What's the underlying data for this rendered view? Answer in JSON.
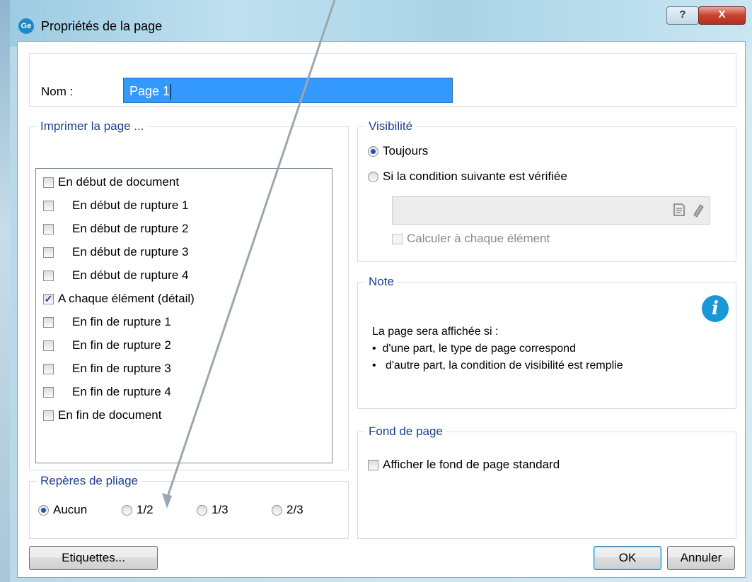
{
  "window": {
    "title": "Propriétés de la page",
    "app_icon_text": "Ge",
    "help_label": "?",
    "close_label": "X"
  },
  "name": {
    "label": "Nom :",
    "value": "Page 1"
  },
  "print_group": {
    "title": "Imprimer la page ...",
    "items": [
      {
        "label": "En début de document",
        "checked": false,
        "indent": false
      },
      {
        "label": "En début de rupture 1",
        "checked": false,
        "indent": true
      },
      {
        "label": "En début de rupture 2",
        "checked": false,
        "indent": true
      },
      {
        "label": "En début de rupture 3",
        "checked": false,
        "indent": true
      },
      {
        "label": "En début de rupture 4",
        "checked": false,
        "indent": true
      },
      {
        "label": "A chaque élément  (détail)",
        "checked": true,
        "indent": false
      },
      {
        "label": "En fin de rupture 1",
        "checked": false,
        "indent": true
      },
      {
        "label": "En fin de rupture 2",
        "checked": false,
        "indent": true
      },
      {
        "label": "En fin de rupture 3",
        "checked": false,
        "indent": true
      },
      {
        "label": "En fin de rupture 4",
        "checked": false,
        "indent": true
      },
      {
        "label": "En fin de document",
        "checked": false,
        "indent": false
      }
    ]
  },
  "visibility": {
    "title": "Visibilité",
    "option_always": "Toujours",
    "option_condition": "Si la condition suivante est vérifiée",
    "selected": "always",
    "condition_value": "",
    "calc_each_label": "Calculer à chaque élément"
  },
  "note": {
    "title": "Note",
    "line1": "La page sera affichée si :",
    "bullet1": "d'une part, le type de page correspond",
    "bullet2": "d'autre part, la condition de visibilité est remplie",
    "bullet_char": "•"
  },
  "background_group": {
    "title": "Fond de page",
    "show_standard_label": "Afficher le fond de page standard"
  },
  "fold_marks": {
    "title": "Repères de pliage",
    "options": [
      "Aucun",
      "1/2",
      "1/3",
      "2/3"
    ],
    "selected": "Aucun"
  },
  "buttons": {
    "labels": "Etiquettes...",
    "ok": "OK",
    "cancel": "Annuler"
  }
}
